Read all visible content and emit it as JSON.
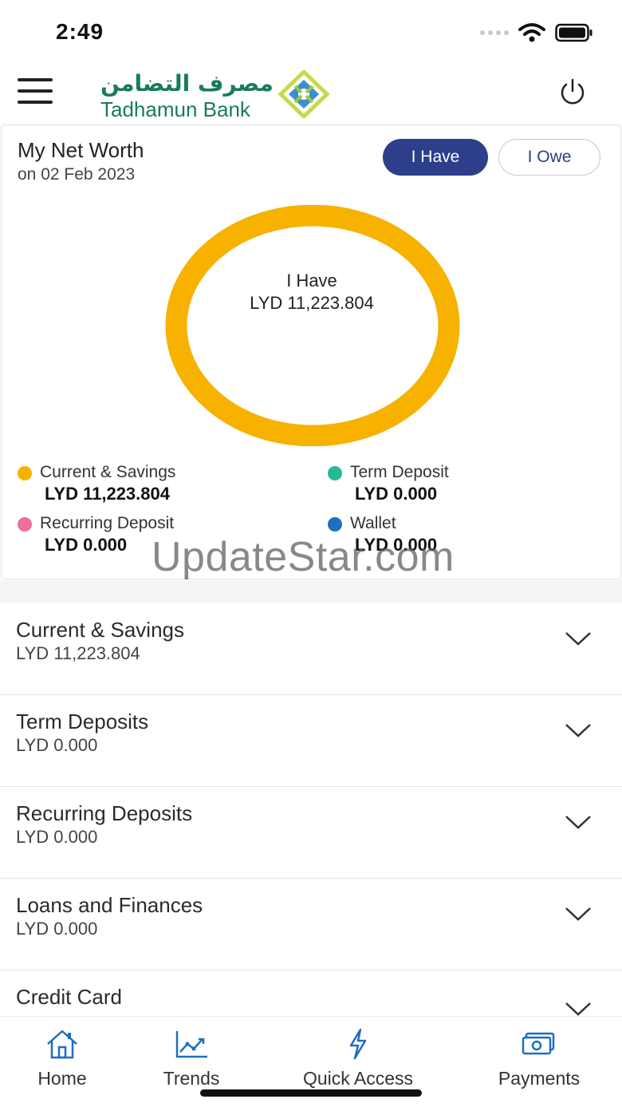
{
  "status_bar": {
    "time": "2:49"
  },
  "header": {
    "logo_arabic": "مصرف التضامن",
    "logo_english": "Tadhamun Bank"
  },
  "net_worth": {
    "title": "My Net Worth",
    "date": "on 02 Feb 2023",
    "toggle_have": "I Have",
    "toggle_owe": "I Owe",
    "center_label": "I Have",
    "center_value": "LYD 11,223.804"
  },
  "chart_data": {
    "type": "pie",
    "title": "",
    "categories": [
      "Current & Savings",
      "Term Deposit",
      "Recurring Deposit",
      "Wallet"
    ],
    "values": [
      11223.804,
      0.0,
      0.0,
      0.0
    ],
    "colors": [
      "#f7b200",
      "#26b89a",
      "#ee6f9a",
      "#1e6fbf"
    ],
    "legend": "bottom"
  },
  "legend": [
    {
      "name": "Current & Savings",
      "amount": "LYD 11,223.804",
      "color": "#f7b200"
    },
    {
      "name": "Term Deposit",
      "amount": "LYD 0.000",
      "color": "#26b89a"
    },
    {
      "name": "Recurring Deposit",
      "amount": "LYD 0.000",
      "color": "#ee6f9a"
    },
    {
      "name": "Wallet",
      "amount": "LYD 0.000",
      "color": "#1e6fbf"
    }
  ],
  "watermark": "UpdateStar.com",
  "accounts": [
    {
      "name": "Current & Savings",
      "amount": "LYD 11,223.804"
    },
    {
      "name": "Term Deposits",
      "amount": "LYD 0.000"
    },
    {
      "name": "Recurring Deposits",
      "amount": "LYD 0.000"
    },
    {
      "name": "Loans and Finances",
      "amount": "LYD 0.000"
    },
    {
      "name": "Credit Card",
      "amount": ""
    }
  ],
  "bottom_nav": [
    {
      "label": "Home",
      "icon": "home-icon"
    },
    {
      "label": "Trends",
      "icon": "trends-icon"
    },
    {
      "label": "Quick Access",
      "icon": "lightning-icon"
    },
    {
      "label": "Payments",
      "icon": "payments-icon"
    }
  ],
  "colors": {
    "primary": "#2d3e8a",
    "brand_green": "#1a7a5e",
    "donut": "#f7b200",
    "nav_icon": "#1e6fbf"
  }
}
